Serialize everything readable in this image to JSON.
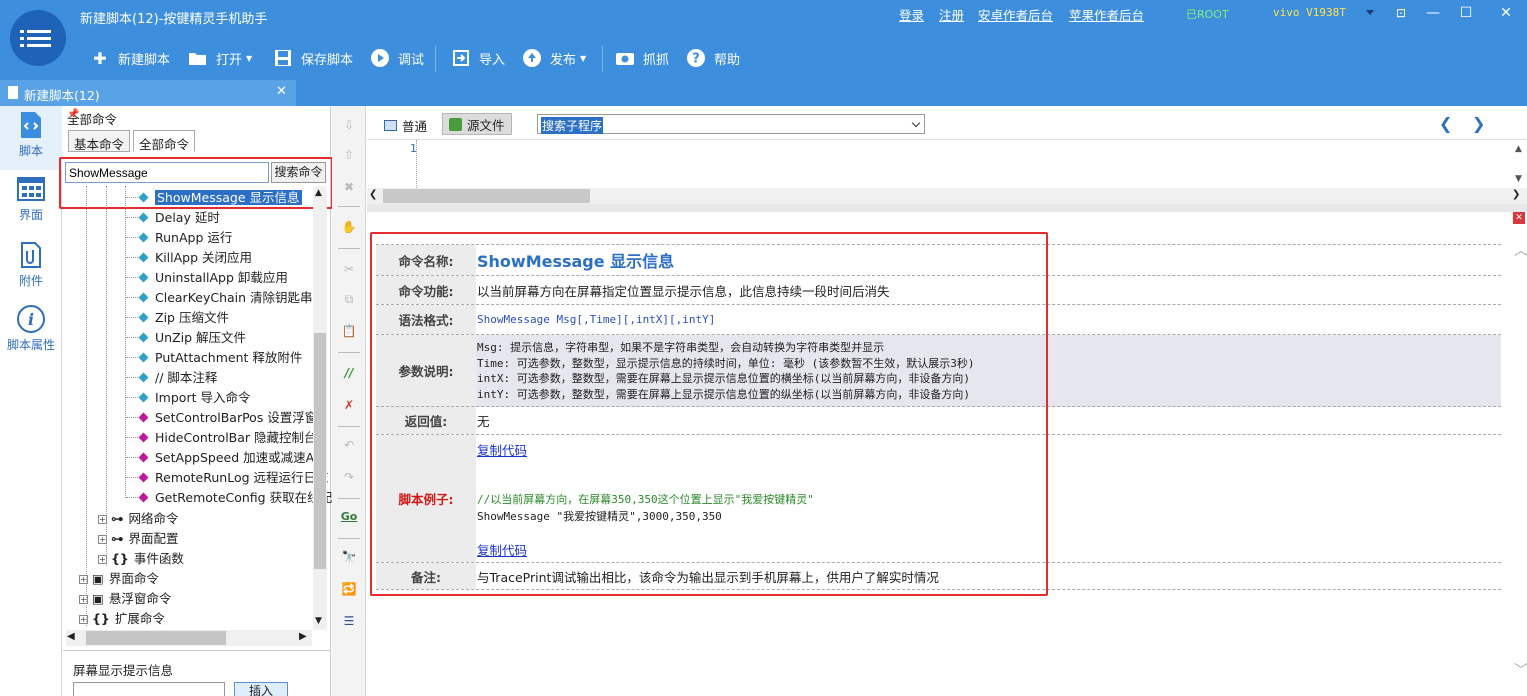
{
  "titlebar": {
    "title": "新建脚本(12)-按键精灵手机助手",
    "links": {
      "login": "登录",
      "register": "注册",
      "android_backend": "安卓作者后台",
      "apple_backend": "苹果作者后台"
    },
    "root": "已ROOT",
    "device": "vivo  V1938T",
    "controls": {
      "restore": "⊡",
      "minimize": "—",
      "maximize": "☐",
      "close": "✕"
    }
  },
  "toolbar": {
    "new": "新建脚本",
    "open": "打开",
    "save": "保存脚本",
    "debug": "调试",
    "import": "导入",
    "publish": "发布",
    "capture": "抓抓",
    "help": "帮助"
  },
  "doc_tab": {
    "label": "新建脚本(12)",
    "close": "✕"
  },
  "leftnav": [
    {
      "label": "脚本",
      "icon": "script-icon"
    },
    {
      "label": "界面",
      "icon": "ui-grid-icon"
    },
    {
      "label": "附件",
      "icon": "attachment-icon"
    },
    {
      "label": "脚本属性",
      "icon": "info-icon"
    }
  ],
  "command_panel": {
    "header": "全部命令",
    "tabs": [
      "基本命令",
      "全部命令"
    ],
    "search_value": "ShowMessage",
    "search_button": "搜索命令",
    "items": [
      {
        "label": "ShowMessage 显示信息",
        "color": "#2aa4c6",
        "selected": true
      },
      {
        "label": "Delay 延时",
        "color": "#2aa4c6"
      },
      {
        "label": "RunApp 运行",
        "color": "#2aa4c6"
      },
      {
        "label": "KillApp 关闭应用",
        "color": "#2aa4c6"
      },
      {
        "label": "UninstallApp 卸载应用",
        "color": "#2aa4c6"
      },
      {
        "label": "ClearKeyChain 清除钥匙串",
        "color": "#2aa4c6"
      },
      {
        "label": "Zip 压缩文件",
        "color": "#2aa4c6"
      },
      {
        "label": "UnZip 解压文件",
        "color": "#2aa4c6"
      },
      {
        "label": "PutAttachment 释放附件",
        "color": "#2aa4c6"
      },
      {
        "label": "// 脚本注释",
        "color": "#2aa4c6"
      },
      {
        "label": "Import 导入命令",
        "color": "#2aa4c6"
      },
      {
        "label": "SetControlBarPos 设置浮窗",
        "color": "#c2189a"
      },
      {
        "label": "HideControlBar 隐藏控制台",
        "color": "#c2189a"
      },
      {
        "label": "SetAppSpeed 加速或减速AP",
        "color": "#c2189a"
      },
      {
        "label": "RemoteRunLog 远程运行日志",
        "color": "#c2189a"
      },
      {
        "label": "GetRemoteConfig 获取在线配",
        "color": "#c2189a"
      }
    ],
    "groups_inner": [
      {
        "label": "网络命令",
        "icon": "network-icon"
      },
      {
        "label": "界面配置",
        "icon": "network-icon"
      },
      {
        "label": "事件函数",
        "icon": "braces-icon"
      }
    ],
    "groups_outer": [
      {
        "label": "界面命令",
        "icon": "window-icon"
      },
      {
        "label": "悬浮窗命令",
        "icon": "window-icon"
      },
      {
        "label": "扩展命令",
        "icon": "braces-icon"
      }
    ],
    "bottom_label": "屏幕显示提示信息",
    "insert_button": "插入"
  },
  "editor": {
    "mode_normal": "普通",
    "mode_source": "源文件",
    "proc_select": "搜索子程序",
    "line_number": "1"
  },
  "help": {
    "rows": [
      {
        "key": "命令名称:",
        "value": "ShowMessage 显示信息"
      },
      {
        "key": "命令功能:",
        "value": "以当前屏幕方向在屏幕指定位置显示提示信息，此信息持续一段时间后消失"
      },
      {
        "key": "语法格式:",
        "value": "ShowMessage  Msg[,Time][,intX][,intY]"
      },
      {
        "key": "参数说明:",
        "lines": [
          "Msg: 提示信息，字符串型，如果不是字符串类型，会自动转换为字符串类型并显示",
          "Time: 可选参数，整数型，显示提示信息的持续时间，单位: 毫秒 (该参数暂不生效，默认展示3秒)",
          "intX: 可选参数，整数型，需要在屏幕上显示提示信息位置的横坐标(以当前屏幕方向，非设备方向)",
          "intY: 可选参数，整数型，需要在屏幕上显示提示信息位置的纵坐标(以当前屏幕方向，非设备方向)"
        ]
      },
      {
        "key": "返回值:",
        "value": "无"
      },
      {
        "key": "脚本例子:",
        "copy1": "复制代码",
        "comment": "//以当前屏幕方向，在屏幕350,350这个位置上显示\"我爱按键精灵\"",
        "code": "ShowMessage \"我爱按键精灵\",3000,350,350",
        "copy2": "复制代码"
      },
      {
        "key": "备注:",
        "value": "与TracePrint调试输出相比，该命令为输出显示到手机屏幕上，供用户了解实时情况"
      }
    ]
  }
}
